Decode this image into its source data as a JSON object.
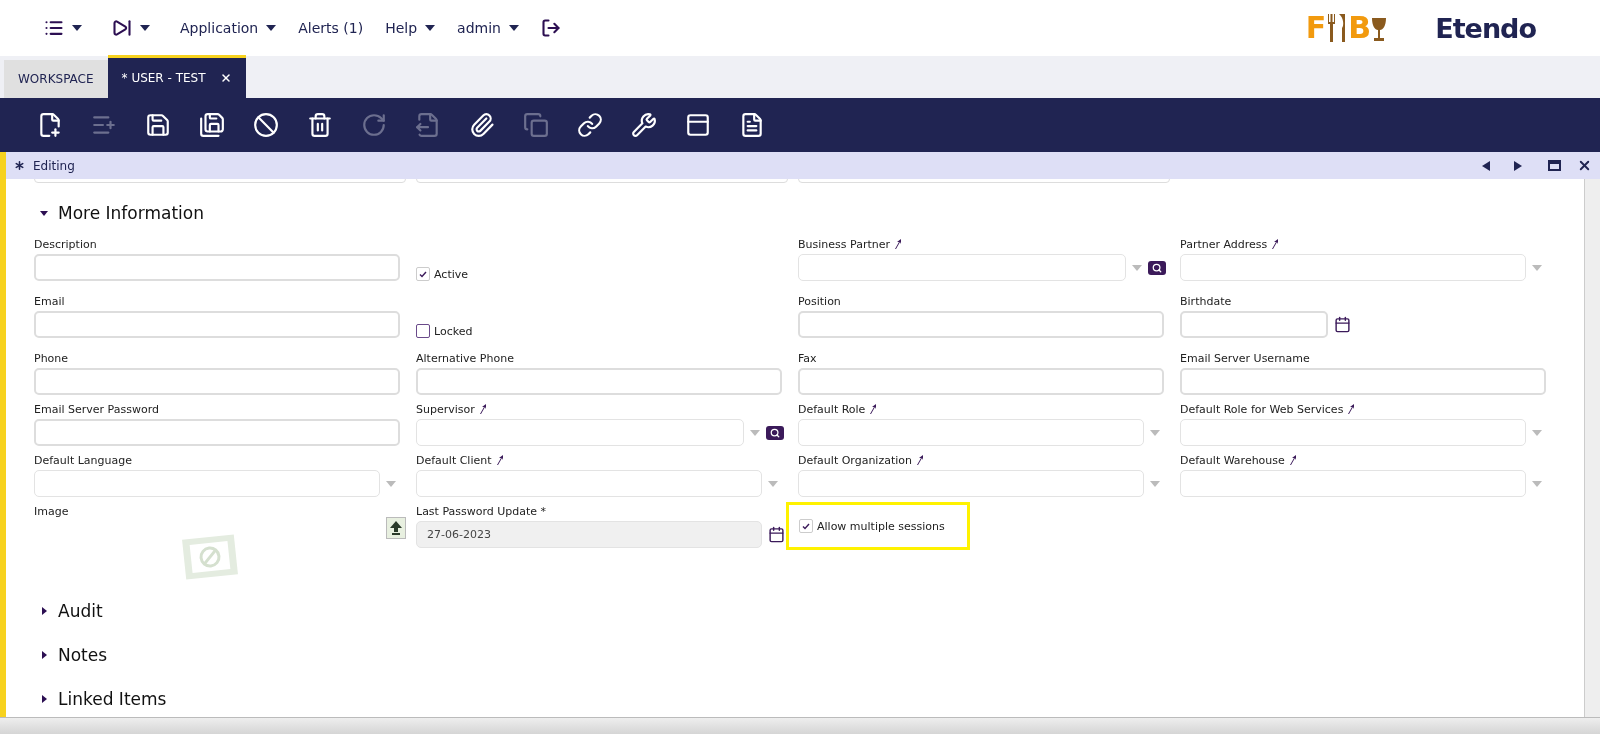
{
  "top_menu": [
    {
      "kind": "icon",
      "dropdown": true
    },
    {
      "kind": "icon",
      "dropdown": true
    },
    {
      "kind": "text",
      "label": "Application",
      "dropdown": true
    },
    {
      "kind": "text",
      "label": "Alerts (1)",
      "dropdown": false
    },
    {
      "kind": "text",
      "label": "Help",
      "dropdown": true
    },
    {
      "kind": "text",
      "label": "admin",
      "dropdown": true
    },
    {
      "kind": "icon",
      "dropdown": false
    }
  ],
  "logos": {
    "fb_letters": [
      "F",
      "B"
    ],
    "brand": "Etendo"
  },
  "tabs": [
    {
      "label": "WORKSPACE",
      "selected": false,
      "closable": false
    },
    {
      "label": "* USER - TEST",
      "selected": true,
      "closable": true
    }
  ],
  "toolbar": [
    {
      "disabled": false
    },
    {
      "disabled": true
    },
    {
      "disabled": false
    },
    {
      "disabled": false
    },
    {
      "disabled": false
    },
    {
      "disabled": false
    },
    {
      "disabled": true
    },
    {
      "disabled": true
    },
    {
      "disabled": false
    },
    {
      "disabled": true
    },
    {
      "disabled": false
    },
    {
      "disabled": false
    },
    {
      "disabled": false
    },
    {
      "disabled": false
    }
  ],
  "status": {
    "label": "Editing"
  },
  "sections": [
    {
      "title": "More Information",
      "expanded": true,
      "fields": [
        {
          "kind": "text",
          "label": "Description",
          "linked": false
        },
        {
          "kind": "checkbox",
          "label": "Active",
          "checked": true,
          "highlighted": false
        },
        {
          "kind": "selector",
          "label": "Business Partner",
          "linked": true
        },
        {
          "kind": "combo",
          "label": "Partner Address",
          "linked": true
        },
        {
          "kind": "text",
          "label": "Email",
          "linked": false
        },
        {
          "kind": "checkbox",
          "label": "Locked",
          "checked": false,
          "highlighted": false
        },
        {
          "kind": "text",
          "label": "Position",
          "linked": false
        },
        {
          "kind": "date",
          "label": "Birthdate",
          "linked": false,
          "readonly": false
        },
        {
          "kind": "text",
          "label": "Phone",
          "linked": false
        },
        {
          "kind": "text",
          "label": "Alternative Phone",
          "linked": false
        },
        {
          "kind": "text",
          "label": "Fax",
          "linked": false
        },
        {
          "kind": "text",
          "label": "Email Server Username",
          "linked": false
        },
        {
          "kind": "text",
          "label": "Email Server Password",
          "linked": false
        },
        {
          "kind": "selector",
          "label": "Supervisor",
          "linked": true
        },
        {
          "kind": "combo",
          "label": "Default Role",
          "linked": true
        },
        {
          "kind": "combo",
          "label": "Default Role for Web Services",
          "linked": true
        },
        {
          "kind": "combo",
          "label": "Default Language",
          "linked": false
        },
        {
          "kind": "combo",
          "label": "Default Client",
          "linked": true
        },
        {
          "kind": "combo",
          "label": "Default Organization",
          "linked": true
        },
        {
          "kind": "combo",
          "label": "Default Warehouse",
          "linked": true
        },
        {
          "kind": "image",
          "label": "Image",
          "linked": false
        },
        {
          "kind": "longdate",
          "label": "Last Password Update *",
          "value": "27-06-2023",
          "linked": false,
          "readonly": true
        },
        {
          "kind": "checkbox",
          "label": "Allow multiple sessions",
          "checked": true,
          "highlighted": true
        }
      ]
    },
    {
      "title": "Audit",
      "expanded": false
    },
    {
      "title": "Notes",
      "expanded": false
    },
    {
      "title": "Linked Items",
      "expanded": false
    }
  ]
}
